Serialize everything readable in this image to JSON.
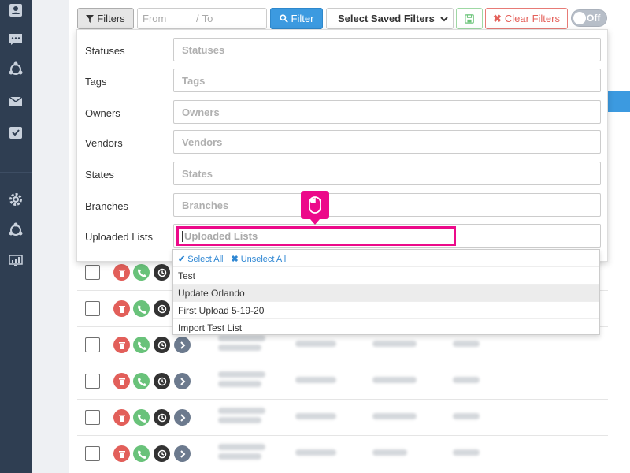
{
  "toolbar": {
    "filters_label": "Filters",
    "date_from_placeholder": "From",
    "date_to_placeholder": "To",
    "date_separator": "/",
    "filter_button_label": "Filter",
    "saved_filters_label": "Select Saved Filters",
    "clear_filters_label": "Clear Filters",
    "toggle_label": "Off"
  },
  "filters": [
    {
      "label": "Statuses",
      "placeholder": "Statuses"
    },
    {
      "label": "Tags",
      "placeholder": "Tags"
    },
    {
      "label": "Owners",
      "placeholder": "Owners"
    },
    {
      "label": "Vendors",
      "placeholder": "Vendors"
    },
    {
      "label": "States",
      "placeholder": "States"
    },
    {
      "label": "Branches",
      "placeholder": "Branches"
    },
    {
      "label": "Uploaded Lists",
      "placeholder": "Uploaded Lists"
    }
  ],
  "dropdown": {
    "select_all": "Select All",
    "unselect_all": "Unselect All",
    "options": [
      "Test",
      "Update Orlando",
      "First Upload 5-19-20",
      "Import Test List"
    ],
    "highlighted_index": 1
  },
  "icons": {
    "sidebar": [
      "contact-card-icon",
      "chat-icon",
      "network-icon",
      "envelope-icon",
      "task-check-icon",
      "gear-icon",
      "network-icon",
      "monitor-chart-icon"
    ],
    "callout": "mouse-icon"
  },
  "colors": {
    "sidebar": "#2f3e52",
    "primary": "#3c9ae0",
    "danger": "#e4625c",
    "success": "#69c27a",
    "highlight": "#ec0a8a"
  }
}
